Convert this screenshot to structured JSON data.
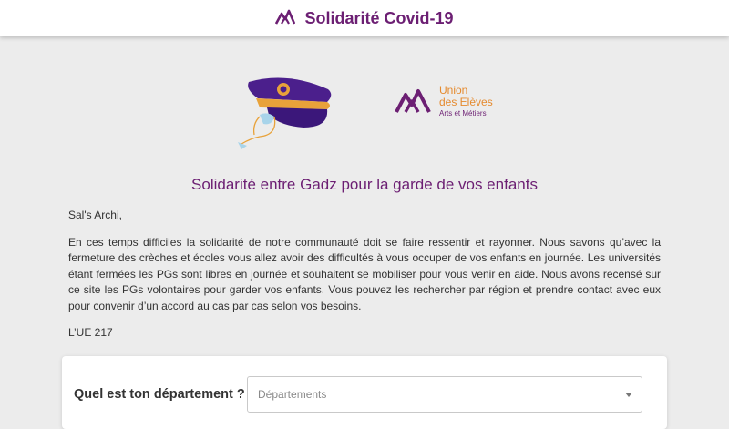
{
  "header": {
    "title": "Solidarité Covid-19",
    "logo_icon": "ue-mountain-icon",
    "brand_color": "#6c1f73"
  },
  "partner_logo": {
    "line1": "Union",
    "line2": "des Elèves",
    "line3": "Arts et Métiers"
  },
  "hero": {
    "icon": "gadz-cap-illustration"
  },
  "headline": "Solidarité entre Gadz pour la garde de vos enfants",
  "content": {
    "greeting": "Sal's Archi,",
    "body": "En ces temps difficiles la solidarité de notre communauté doit se faire ressentir et rayonner. Nous savons qu’avec la fermeture des crèches et écoles vous allez avoir des difficultés à vous occuper de vos enfants en journée. Les universités étant fermées les PGs sont libres en journée et souhaitent se mobiliser pour vous venir en aide. Nous avons recensé sur ce site les PGs volontaires pour garder vos enfants. Vous pouvez les rechercher par région et prendre contact avec eux pour convenir d’un accord au cas par cas selon vos besoins.",
    "signature": "L’UE 217"
  },
  "form": {
    "question": "Quel est ton département ?",
    "select_placeholder": "Départements"
  },
  "colors": {
    "accent": "#6c1f73",
    "orange": "#e58a2e",
    "background": "#ececec"
  }
}
